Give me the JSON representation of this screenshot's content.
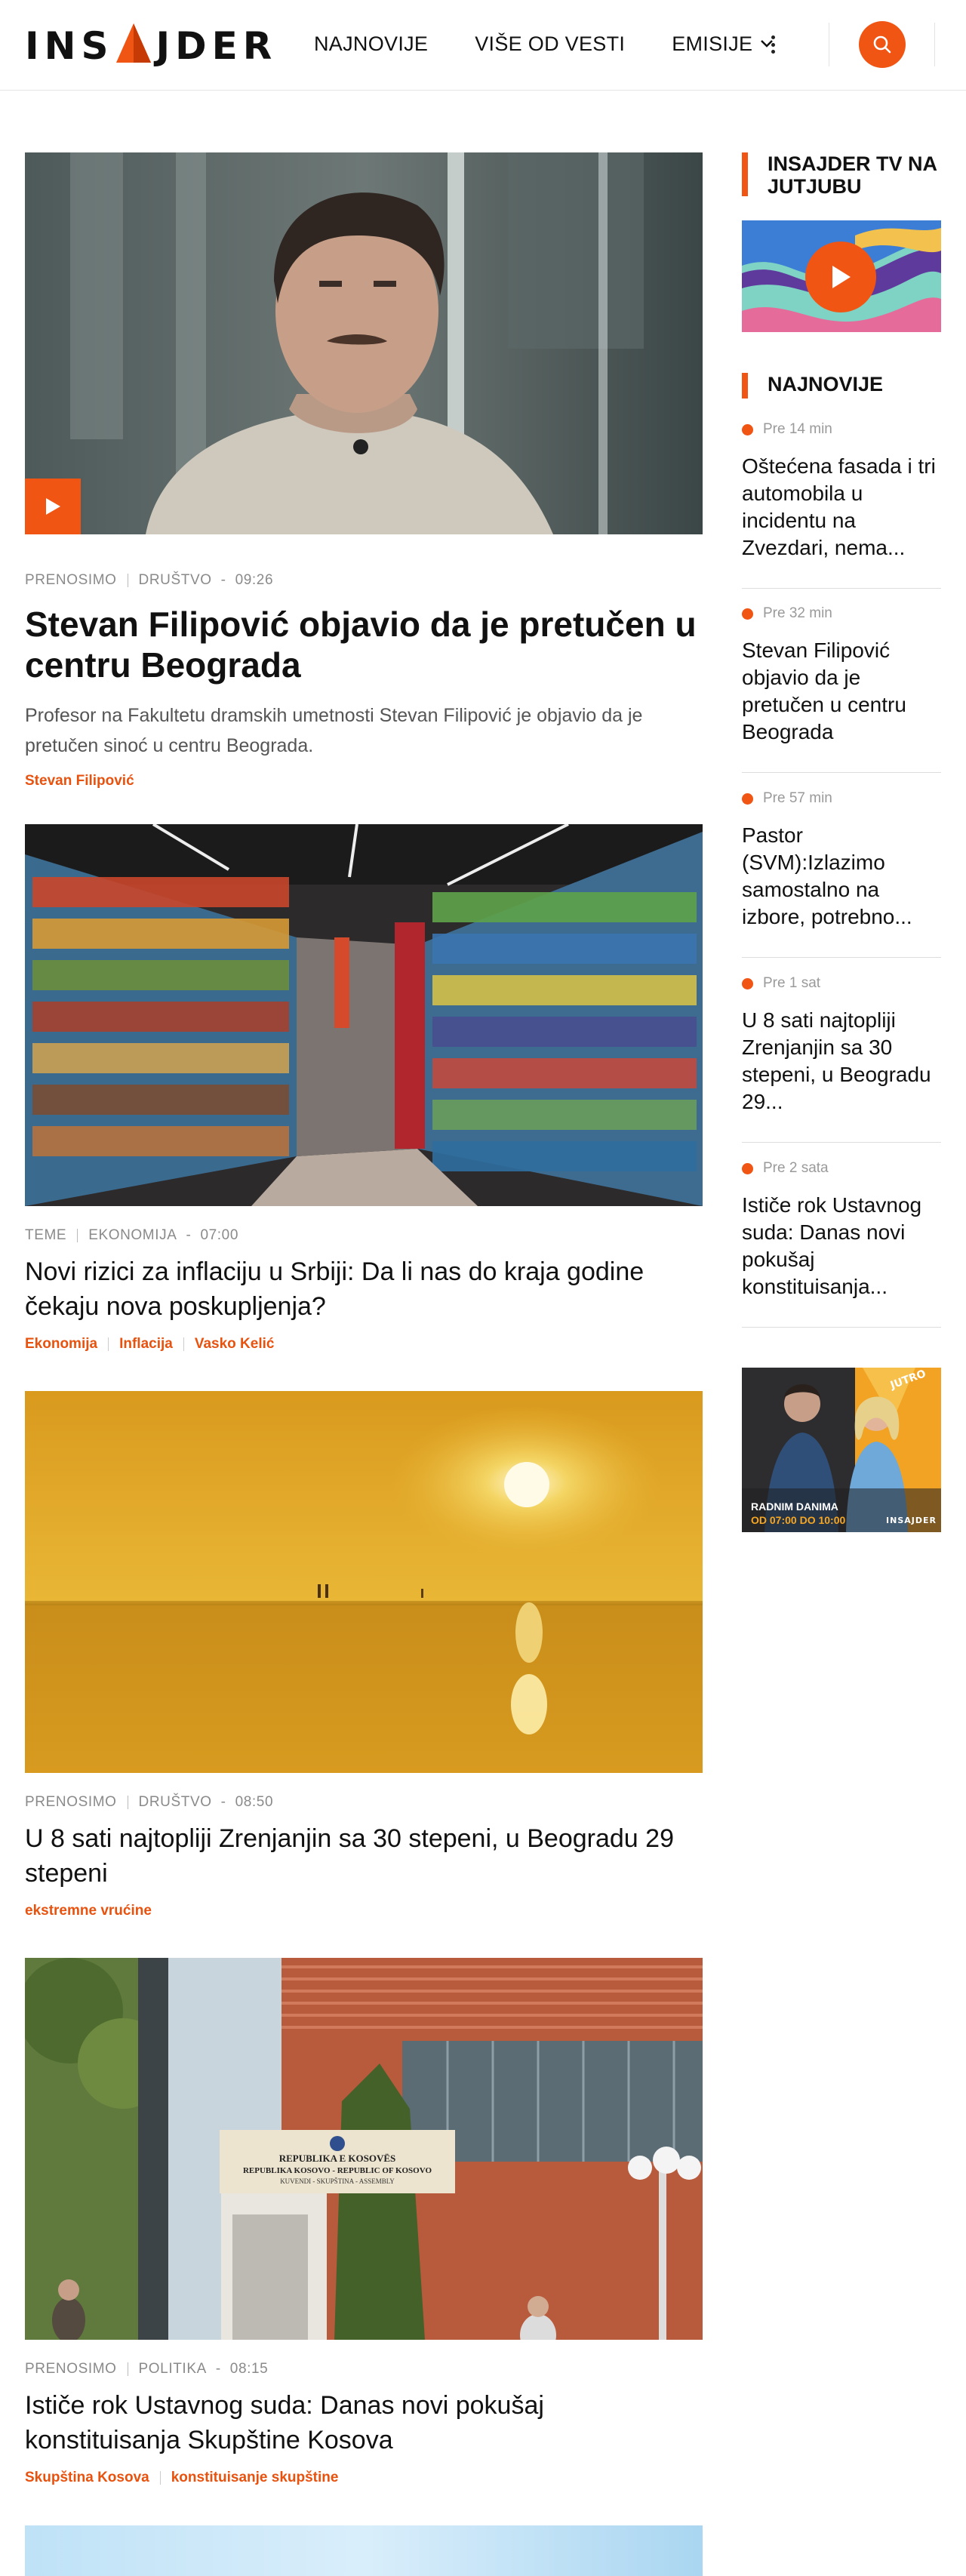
{
  "brand": {
    "logo_left": "INS",
    "logo_right": "JDER",
    "accent": "#F05514"
  },
  "nav": {
    "items": [
      {
        "label": "NAJNOVIJE"
      },
      {
        "label": "VIŠE OD VESTI"
      },
      {
        "label": "EMISIJE"
      }
    ],
    "menu_icon": "more-vertical-icon",
    "search_icon": "search-icon"
  },
  "articles": [
    {
      "category": "PRENOSIMO",
      "section": "DRUŠTVO",
      "time": "09:26",
      "title": "Stevan Filipović objavio da je pretučen u centru Beograda",
      "lead": "Profesor na Fakultetu dramskih umetnosti Stevan Filipović je objavio da je pretučen sinoć u centru Beograda.",
      "tags": [
        "Stevan Filipović"
      ],
      "has_video": true
    },
    {
      "category": "TEME",
      "section": "EKONOMIJA",
      "time": "07:00",
      "title": "Novi rizici za inflaciju u Srbiji: Da li nas do kraja godine čekaju nova poskupljenja?",
      "tags": [
        "Ekonomija",
        "Inflacija",
        "Vasko Kelić"
      ]
    },
    {
      "category": "PRENOSIMO",
      "section": "DRUŠTVO",
      "time": "08:50",
      "title": "U 8 sati najtopliji Zrenjanjin sa 30 stepeni, u Beogradu 29 stepeni",
      "tags": [
        "ekstremne vrućine"
      ]
    },
    {
      "category": "PRENOSIMO",
      "section": "POLITIKA",
      "time": "08:15",
      "title": "Ističe rok Ustavnog suda: Danas novi pokušaj konstituisanja Skupštine Kosova",
      "tags": [
        "Skupština Kosova",
        "konstituisanje skupštine"
      ],
      "sign_lines": [
        "REPUBLIKA E KOSOVËS",
        "REPUBLIKA KOSOVO - REPUBLIC OF KOSOVO",
        "KUVENDI - SKUPŠTINA - ASSEMBLY"
      ]
    }
  ],
  "sidebar": {
    "youtube_heading": "INSAJDER TV NA JUTJUBU",
    "latest_heading": "NAJNOVIJE",
    "latest": [
      {
        "time": "Pre 14 min",
        "title": "Oštećena fasada i tri automobila u incidentu na Zvezdari, nema..."
      },
      {
        "time": "Pre 32 min",
        "title": "Stevan Filipović objavio da je pretučen u centru Beograda"
      },
      {
        "time": "Pre 57 min",
        "title": "Pastor (SVM):Izlazimo samostalno na izbore, potrebno..."
      },
      {
        "time": "Pre 1 sat",
        "title": "U 8 sati najtopliji Zrenjanjin sa 30 stepeni, u Beogradu 29..."
      },
      {
        "time": "Pre 2 sata",
        "title": "Ističe rok Ustavnog suda: Danas novi pokušaj konstituisanja..."
      }
    ],
    "promo": {
      "show": "RADNIM DANIMA",
      "hours": "OD 07:00 DO 10:00",
      "brand": "INSAJDER",
      "badge": "JUTRO"
    }
  }
}
